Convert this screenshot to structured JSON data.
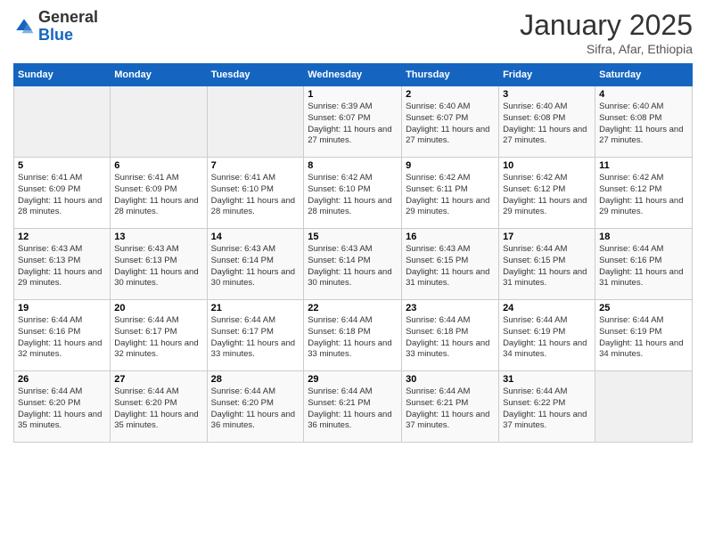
{
  "header": {
    "logo_general": "General",
    "logo_blue": "Blue",
    "month_year": "January 2025",
    "location": "Sifra, Afar, Ethiopia"
  },
  "weekdays": [
    "Sunday",
    "Monday",
    "Tuesday",
    "Wednesday",
    "Thursday",
    "Friday",
    "Saturday"
  ],
  "weeks": [
    [
      {
        "day": "",
        "empty": true
      },
      {
        "day": "",
        "empty": true
      },
      {
        "day": "",
        "empty": true
      },
      {
        "day": "1",
        "sunrise": "6:39 AM",
        "sunset": "6:07 PM",
        "daylight": "11 hours and 27 minutes."
      },
      {
        "day": "2",
        "sunrise": "6:40 AM",
        "sunset": "6:07 PM",
        "daylight": "11 hours and 27 minutes."
      },
      {
        "day": "3",
        "sunrise": "6:40 AM",
        "sunset": "6:08 PM",
        "daylight": "11 hours and 27 minutes."
      },
      {
        "day": "4",
        "sunrise": "6:40 AM",
        "sunset": "6:08 PM",
        "daylight": "11 hours and 27 minutes."
      }
    ],
    [
      {
        "day": "5",
        "sunrise": "6:41 AM",
        "sunset": "6:09 PM",
        "daylight": "11 hours and 28 minutes."
      },
      {
        "day": "6",
        "sunrise": "6:41 AM",
        "sunset": "6:09 PM",
        "daylight": "11 hours and 28 minutes."
      },
      {
        "day": "7",
        "sunrise": "6:41 AM",
        "sunset": "6:10 PM",
        "daylight": "11 hours and 28 minutes."
      },
      {
        "day": "8",
        "sunrise": "6:42 AM",
        "sunset": "6:10 PM",
        "daylight": "11 hours and 28 minutes."
      },
      {
        "day": "9",
        "sunrise": "6:42 AM",
        "sunset": "6:11 PM",
        "daylight": "11 hours and 29 minutes."
      },
      {
        "day": "10",
        "sunrise": "6:42 AM",
        "sunset": "6:12 PM",
        "daylight": "11 hours and 29 minutes."
      },
      {
        "day": "11",
        "sunrise": "6:42 AM",
        "sunset": "6:12 PM",
        "daylight": "11 hours and 29 minutes."
      }
    ],
    [
      {
        "day": "12",
        "sunrise": "6:43 AM",
        "sunset": "6:13 PM",
        "daylight": "11 hours and 29 minutes."
      },
      {
        "day": "13",
        "sunrise": "6:43 AM",
        "sunset": "6:13 PM",
        "daylight": "11 hours and 30 minutes."
      },
      {
        "day": "14",
        "sunrise": "6:43 AM",
        "sunset": "6:14 PM",
        "daylight": "11 hours and 30 minutes."
      },
      {
        "day": "15",
        "sunrise": "6:43 AM",
        "sunset": "6:14 PM",
        "daylight": "11 hours and 30 minutes."
      },
      {
        "day": "16",
        "sunrise": "6:43 AM",
        "sunset": "6:15 PM",
        "daylight": "11 hours and 31 minutes."
      },
      {
        "day": "17",
        "sunrise": "6:44 AM",
        "sunset": "6:15 PM",
        "daylight": "11 hours and 31 minutes."
      },
      {
        "day": "18",
        "sunrise": "6:44 AM",
        "sunset": "6:16 PM",
        "daylight": "11 hours and 31 minutes."
      }
    ],
    [
      {
        "day": "19",
        "sunrise": "6:44 AM",
        "sunset": "6:16 PM",
        "daylight": "11 hours and 32 minutes."
      },
      {
        "day": "20",
        "sunrise": "6:44 AM",
        "sunset": "6:17 PM",
        "daylight": "11 hours and 32 minutes."
      },
      {
        "day": "21",
        "sunrise": "6:44 AM",
        "sunset": "6:17 PM",
        "daylight": "11 hours and 33 minutes."
      },
      {
        "day": "22",
        "sunrise": "6:44 AM",
        "sunset": "6:18 PM",
        "daylight": "11 hours and 33 minutes."
      },
      {
        "day": "23",
        "sunrise": "6:44 AM",
        "sunset": "6:18 PM",
        "daylight": "11 hours and 33 minutes."
      },
      {
        "day": "24",
        "sunrise": "6:44 AM",
        "sunset": "6:19 PM",
        "daylight": "11 hours and 34 minutes."
      },
      {
        "day": "25",
        "sunrise": "6:44 AM",
        "sunset": "6:19 PM",
        "daylight": "11 hours and 34 minutes."
      }
    ],
    [
      {
        "day": "26",
        "sunrise": "6:44 AM",
        "sunset": "6:20 PM",
        "daylight": "11 hours and 35 minutes."
      },
      {
        "day": "27",
        "sunrise": "6:44 AM",
        "sunset": "6:20 PM",
        "daylight": "11 hours and 35 minutes."
      },
      {
        "day": "28",
        "sunrise": "6:44 AM",
        "sunset": "6:20 PM",
        "daylight": "11 hours and 36 minutes."
      },
      {
        "day": "29",
        "sunrise": "6:44 AM",
        "sunset": "6:21 PM",
        "daylight": "11 hours and 36 minutes."
      },
      {
        "day": "30",
        "sunrise": "6:44 AM",
        "sunset": "6:21 PM",
        "daylight": "11 hours and 37 minutes."
      },
      {
        "day": "31",
        "sunrise": "6:44 AM",
        "sunset": "6:22 PM",
        "daylight": "11 hours and 37 minutes."
      },
      {
        "day": "",
        "empty": true
      }
    ]
  ],
  "labels": {
    "sunrise": "Sunrise:",
    "sunset": "Sunset:",
    "daylight": "Daylight:"
  }
}
